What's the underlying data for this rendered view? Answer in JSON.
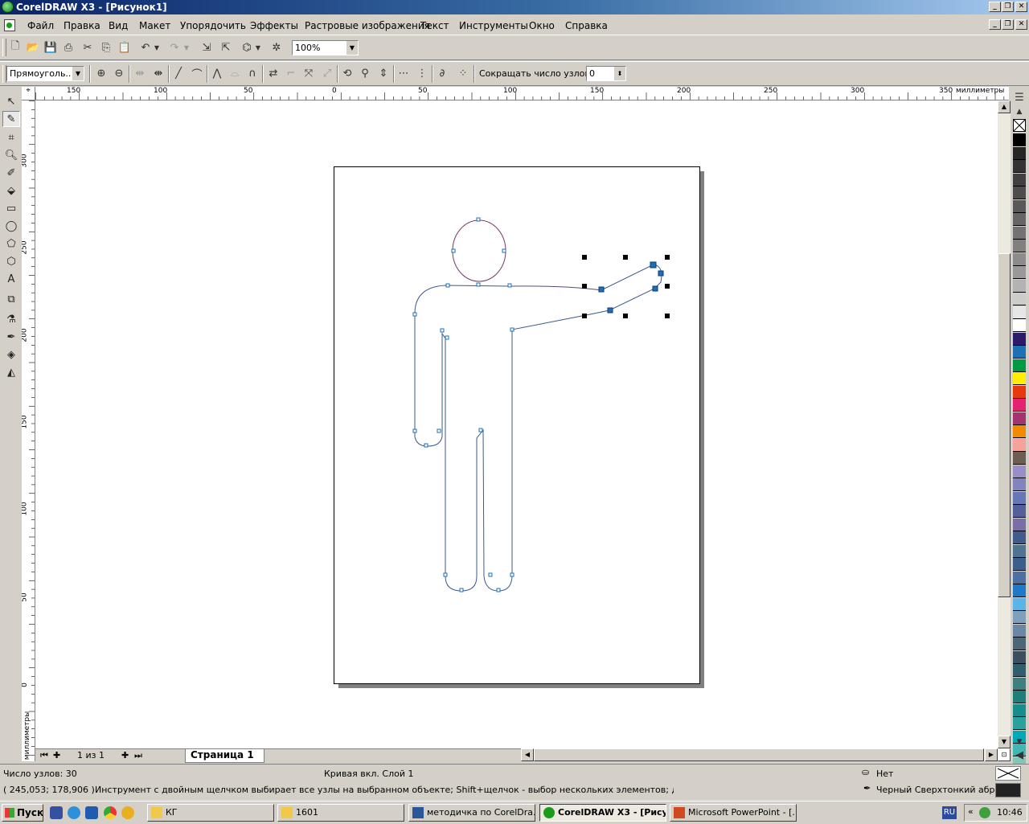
{
  "window": {
    "title": "CorelDRAW X3 - [Рисунок1]",
    "caption_buttons": [
      "_",
      "❐",
      "✕"
    ]
  },
  "menu": {
    "items": [
      "Файл",
      "Правка",
      "Вид",
      "Макет",
      "Упорядочить",
      "Эффекты",
      "Растровые изображения",
      "Текст",
      "Инструменты",
      "Окно",
      "Справка"
    ]
  },
  "toolbar": {
    "zoom_value": "100%"
  },
  "property_bar": {
    "selection_mode": "Прямоуголь...",
    "reduce_nodes_label": "Сокращать число узлов",
    "reduce_nodes_value": "0"
  },
  "rulers": {
    "top_labels": [
      "150",
      "100",
      "50",
      "0",
      "50",
      "100",
      "150",
      "200",
      "250",
      "300",
      "350"
    ],
    "top_unit": "миллиметры",
    "left_labels": [
      "300",
      "250",
      "200",
      "150",
      "100",
      "50",
      "0"
    ],
    "left_unit": "миллиметры"
  },
  "page_nav": {
    "page_count": "1 из 1",
    "page_tab": "Страница 1"
  },
  "status": {
    "node_count": "Число узлов: 30",
    "object_info": "Кривая вкл. Слой 1",
    "coordinates": "( 245,053; 178,906 )",
    "hint": "Инструмент с двойным щелчком выбирает все узлы на выбранном объекте; Shift+щелчок - выбор нескольких элементов; двойной щелч...",
    "fill": "Нет",
    "outline": "Черный  Сверхтонкий абрис"
  },
  "palette": {
    "colors": [
      "#000000",
      "#262626",
      "#333333",
      "#404040",
      "#4d4d4d",
      "#595959",
      "#666666",
      "#737373",
      "#808080",
      "#8c8c8c",
      "#999999",
      "#b3b3b3",
      "#cccccc",
      "#e6e6e6",
      "#ffffff",
      "#2e1a6b",
      "#1f6fb5",
      "#009a44",
      "#ffee00",
      "#e8380d",
      "#e5226f",
      "#a2356f",
      "#f08a00",
      "#f7a19a",
      "#6c5e53",
      "#9a8ec6",
      "#8383c0",
      "#6677b8",
      "#54609a",
      "#7a6ea8",
      "#435b8c",
      "#4f7391",
      "#3b5f8a",
      "#4d6fa3",
      "#1f78c8",
      "#5ab4e6",
      "#7f9fbf",
      "#6a88a5",
      "#4c6678",
      "#3d4f5f",
      "#2f5f6f",
      "#3f7f80",
      "#1e7f7a",
      "#168c8c",
      "#2aa19c",
      "#00a9b5",
      "#3fb7b3",
      "#7fc7b7",
      "#a3d9c8"
    ]
  },
  "taskbar": {
    "start_label": "Пуск",
    "tasks": [
      {
        "label": "КГ",
        "active": false
      },
      {
        "label": "1601",
        "active": false
      },
      {
        "label": "методичка по CorelDra...",
        "active": false
      },
      {
        "label": "CorelDRAW X3 - [Рису...",
        "active": true
      },
      {
        "label": "Microsoft PowerPoint - [...",
        "active": false
      }
    ],
    "language": "RU",
    "clock": "10:46"
  }
}
